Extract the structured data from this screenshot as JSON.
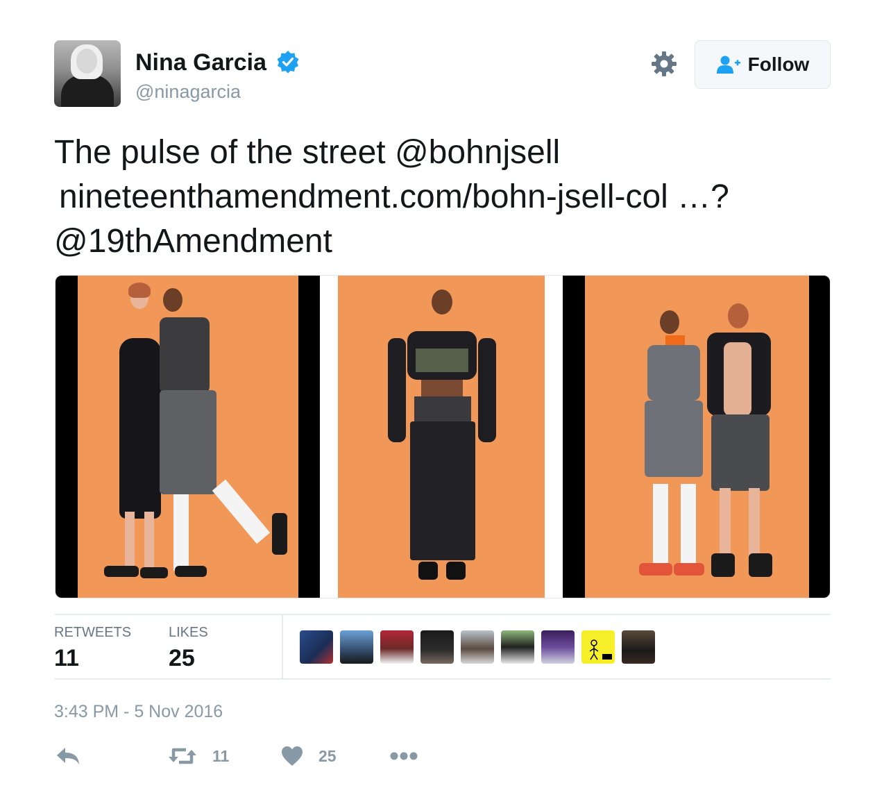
{
  "user": {
    "display_name": "Nina Garcia",
    "handle": "@ninagarcia",
    "verified": true
  },
  "header": {
    "settings_icon": "gear-icon",
    "follow_label": "Follow"
  },
  "tweet": {
    "line1_text": "The pulse of the street ",
    "mention1": "@bohnjsell",
    "link": "nineteenthamendment.com/bohn-jsell-col …?",
    "mention2": "@19thAmendment"
  },
  "stats": {
    "retweets_label": "RETWEETS",
    "retweets_value": "11",
    "likes_label": "LIKES",
    "likes_value": "25",
    "liker_avatar_count": 9
  },
  "timestamp": "3:43 PM - 5 Nov 2016",
  "actions": {
    "reply_icon": "reply-icon",
    "retweet_icon": "retweet-icon",
    "retweet_count": "11",
    "like_icon": "heart-icon",
    "like_count": "25",
    "more_icon": "more-icon"
  },
  "colors": {
    "text": "#14171a",
    "muted": "#8899a6",
    "verified_blue": "#1da1f2",
    "photo_background": "#f19858"
  }
}
